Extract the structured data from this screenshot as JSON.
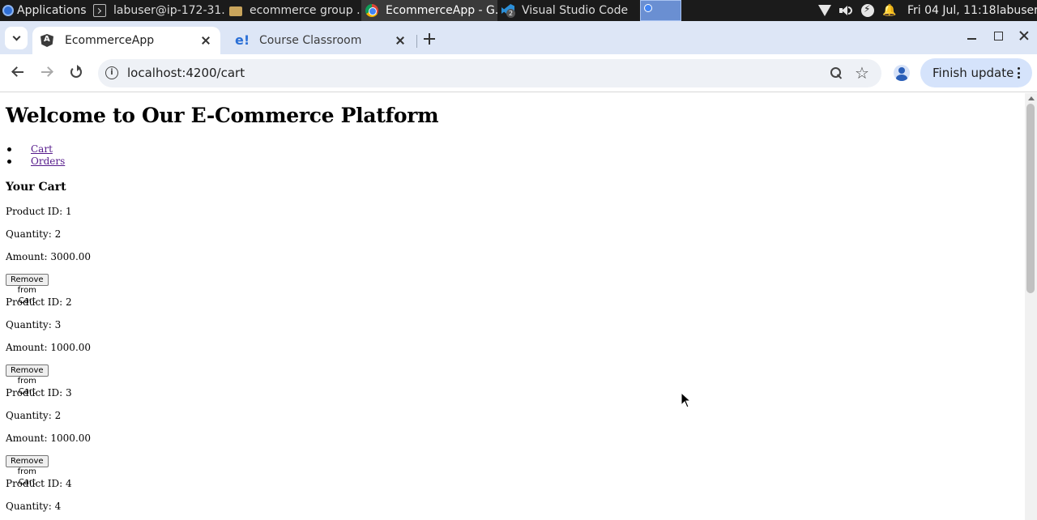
{
  "taskbar": {
    "apps_label": "Applications",
    "tasks": [
      {
        "label": "labuser@ip-172-31...",
        "icon": "terminal-icon"
      },
      {
        "label": "ecommerce group ...",
        "icon": "folder-icon"
      },
      {
        "label": "EcommerceApp - G...",
        "icon": "chrome-icon"
      },
      {
        "label": "Visual Studio Code",
        "icon": "vscode-icon",
        "badge": "2"
      }
    ],
    "clock": "Fri 04 Jul, 11:18",
    "user": "labuser"
  },
  "browser": {
    "tabs": [
      {
        "label": "EcommerceApp",
        "icon": "angular-icon",
        "active": true
      },
      {
        "label": "Course Classroom",
        "icon": "edu-icon",
        "active": false
      }
    ],
    "url": "localhost:4200/cart",
    "finish_update_label": "Finish update"
  },
  "page": {
    "title": "Welcome to Our E-Commerce Platform",
    "nav": [
      {
        "label": "Cart"
      },
      {
        "label": "Orders"
      }
    ],
    "cart_heading": "Your Cart",
    "remove_label": "Remove from Cart",
    "items": [
      {
        "product": "Product ID: 1",
        "quantity": "Quantity: 2",
        "amount": "Amount: 3000.00"
      },
      {
        "product": "Product ID: 2",
        "quantity": "Quantity: 3",
        "amount": "Amount: 1000.00"
      },
      {
        "product": "Product ID: 3",
        "quantity": "Quantity: 2",
        "amount": "Amount: 1000.00"
      },
      {
        "product": "Product ID: 4",
        "quantity": "Quantity: 4",
        "amount": ""
      }
    ]
  }
}
